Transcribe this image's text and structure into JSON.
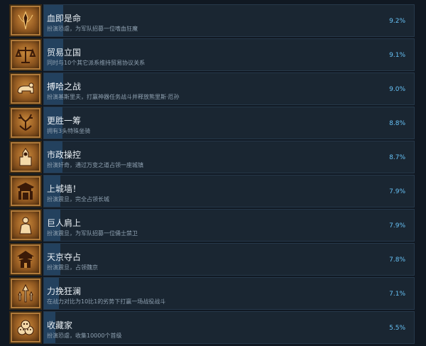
{
  "achievements": [
    {
      "title": "血即是命",
      "desc": "扮演恐虐，为军队招募一位嗜血狂魔",
      "percent": "9.2%",
      "progress": 0.092,
      "icon": "khorne-icon"
    },
    {
      "title": "贸易立国",
      "desc": "同时与10个其它派系维持贸易协议关系",
      "percent": "9.1%",
      "progress": 0.091,
      "icon": "trade-scales-icon"
    },
    {
      "title": "搏哈之战",
      "desc": "扮演基斯里夫，打赢神器任务战斗并释放熊里斯·厄孙",
      "percent": "9.0%",
      "progress": 0.09,
      "icon": "bear-icon"
    },
    {
      "title": "更胜一筹",
      "desc": "拥有3头特殊坐骑",
      "percent": "8.8%",
      "progress": 0.088,
      "icon": "antlers-icon"
    },
    {
      "title": "市政操控",
      "desc": "扮演奸奇，通过万变之道占领一座城镇",
      "percent": "8.7%",
      "progress": 0.087,
      "icon": "tzeentch-icon"
    },
    {
      "title": "上城墙！",
      "desc": "扮演震旦，完全占领长城",
      "percent": "7.9%",
      "progress": 0.079,
      "icon": "great-wall-icon"
    },
    {
      "title": "巨人肩上",
      "desc": "扮演震旦，为军队招募一位俑士禁卫",
      "percent": "7.9%",
      "progress": 0.079,
      "icon": "terracotta-guard-icon"
    },
    {
      "title": "天京夺占",
      "desc": "扮演震旦，占领魏京",
      "percent": "7.8%",
      "progress": 0.078,
      "icon": "palace-icon"
    },
    {
      "title": "力挽狂澜",
      "desc": "在战力对比为10比1的劣势下打赢一场战役战斗",
      "percent": "7.1%",
      "progress": 0.071,
      "icon": "rising-power-icon"
    },
    {
      "title": "收藏家",
      "desc": "扮演恐虐，收集10000个首级",
      "percent": "5.5%",
      "progress": 0.055,
      "icon": "skull-pile-icon"
    }
  ]
}
